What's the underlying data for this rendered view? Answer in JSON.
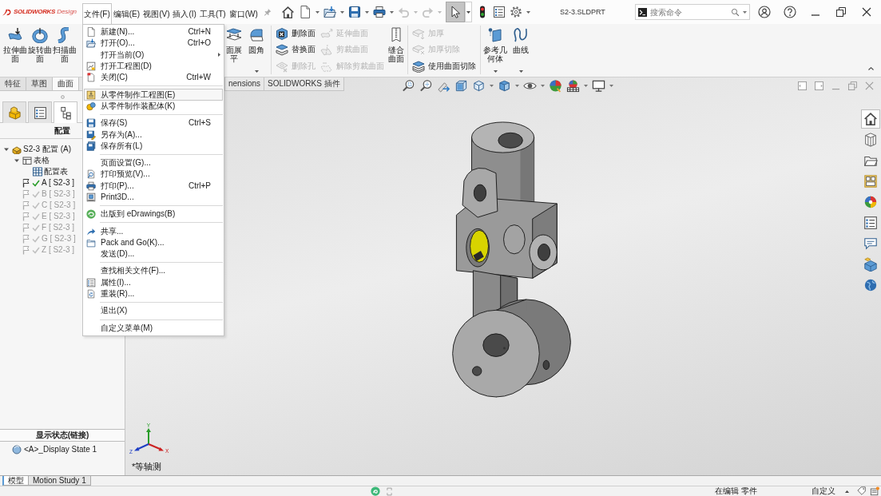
{
  "logo": {
    "brand": "**SOLID**WORKS",
    "edition": "Design"
  },
  "menu_bar": [
    {
      "label": "文件(F)",
      "selected": true
    },
    {
      "label": "编辑(E)",
      "selected": false
    },
    {
      "label": "视图(V)",
      "selected": false
    },
    {
      "label": "插入(I)",
      "selected": false
    },
    {
      "label": "工具(T)",
      "selected": false
    },
    {
      "label": "窗口(W)",
      "selected": false
    }
  ],
  "quick_access": {
    "undo": {
      "disabled": true
    },
    "redo": {
      "disabled": true
    },
    "select": {
      "selected": true
    }
  },
  "document_title": "S2-3.SLDPRT",
  "search": {
    "placeholder": "搜索命令"
  },
  "ribbon": [
    {
      "items": [
        {
          "kind": "large",
          "label": "拉伸曲面",
          "disabled": false,
          "dropdown": false
        },
        {
          "kind": "large",
          "label": "旋转曲面",
          "disabled": false,
          "dropdown": false
        },
        {
          "kind": "large",
          "label": "扫描曲面",
          "disabled": false,
          "dropdown": false
        }
      ]
    },
    {
      "items": [
        {
          "kind": "large",
          "label": "面展平",
          "disabled": false,
          "dropdown": false
        },
        {
          "kind": "large",
          "label": "圆角",
          "disabled": false,
          "dropdown": true
        }
      ]
    },
    {
      "items": [
        {
          "kind": "small",
          "label": "删除面",
          "disabled": false,
          "dropdown": false
        },
        {
          "kind": "small",
          "label": "替换面",
          "disabled": false,
          "dropdown": false
        },
        {
          "kind": "small",
          "label": "删除孔",
          "disabled": true,
          "dropdown": false
        },
        {
          "kind": "small",
          "label": "延伸曲面",
          "disabled": true,
          "dropdown": false
        },
        {
          "kind": "small",
          "label": "剪裁曲面",
          "disabled": true,
          "dropdown": false
        },
        {
          "kind": "small",
          "label": "解除剪裁曲面",
          "disabled": true,
          "dropdown": false
        },
        {
          "kind": "large",
          "label": "缝合曲面",
          "disabled": false,
          "dropdown": false
        }
      ]
    },
    {
      "items": [
        {
          "kind": "small",
          "label": "加厚",
          "disabled": true,
          "dropdown": false
        },
        {
          "kind": "small",
          "label": "加厚切除",
          "disabled": true,
          "dropdown": false
        },
        {
          "kind": "small",
          "label": "使用曲面切除",
          "disabled": false,
          "dropdown": false
        }
      ]
    },
    {
      "items": [
        {
          "kind": "large",
          "label": "参考几何体",
          "disabled": false,
          "dropdown": true
        },
        {
          "kind": "large",
          "label": "曲线",
          "disabled": false,
          "dropdown": true
        }
      ]
    }
  ],
  "command_tabs": [
    {
      "label": "特征",
      "selected": false
    },
    {
      "label": "草图",
      "selected": false
    },
    {
      "label": "曲面",
      "selected": true
    },
    {
      "label": "nensions",
      "selected": false
    },
    {
      "label": "SOLIDWORKS 插件",
      "selected": false
    }
  ],
  "manager_tabs": [
    {
      "selected": false
    },
    {
      "selected": false
    },
    {
      "selected": true
    }
  ],
  "panel_title": "配置",
  "config_tree": [
    {
      "kind": "part",
      "label": "S2-3 配置 (A)",
      "expanded": true,
      "children": [
        {
          "kind": "folder",
          "label": "表格",
          "expanded": true,
          "children": [
            {
              "kind": "table",
              "label": "配置表"
            }
          ]
        },
        {
          "kind": "config",
          "label": "A [ S2-3 ]",
          "active": true
        },
        {
          "kind": "config",
          "label": "B [ S2-3 ]",
          "active": false
        },
        {
          "kind": "config",
          "label": "C [ S2-3 ]",
          "active": false
        },
        {
          "kind": "config",
          "label": "E [ S2-3 ]",
          "active": false
        },
        {
          "kind": "config",
          "label": "F [ S2-3 ]",
          "active": false
        },
        {
          "kind": "config",
          "label": "G [ S2-3 ]",
          "active": false
        },
        {
          "kind": "config",
          "label": "Z [ S2-3 ]",
          "active": false
        }
      ]
    }
  ],
  "display_states": {
    "title": "显示状态(链接)",
    "items": [
      {
        "label": "<A>_Display State 1"
      }
    ]
  },
  "task_pane": [
    {
      "selected": true
    },
    {
      "selected": false
    },
    {
      "selected": false
    },
    {
      "selected": false
    },
    {
      "selected": false
    },
    {
      "selected": false
    },
    {
      "selected": false
    },
    {
      "selected": false
    },
    {
      "selected": false
    }
  ],
  "viewport": {
    "view_name": "*等轴测",
    "axes": [
      "X",
      "Y",
      "Z"
    ]
  },
  "model_tabs": [
    {
      "label": "模型",
      "selected": true
    },
    {
      "label": "Motion Study 1",
      "selected": false
    }
  ],
  "status_bar": {
    "state": "在编辑 零件",
    "units": "自定义"
  },
  "file_menu": [
    {
      "kind": "item",
      "label": "新建(N)...",
      "shortcut": "Ctrl+N",
      "selected": false,
      "submenu": false
    },
    {
      "kind": "item",
      "label": "打开(O)...",
      "shortcut": "Ctrl+O",
      "selected": false,
      "submenu": false
    },
    {
      "kind": "item",
      "label": "打开当前(O)",
      "selected": false,
      "submenu": true
    },
    {
      "kind": "item",
      "label": "打开工程图(D)",
      "selected": false,
      "submenu": false
    },
    {
      "kind": "item",
      "label": "关闭(C)",
      "shortcut": "Ctrl+W",
      "selected": false,
      "submenu": false
    },
    {
      "kind": "separator"
    },
    {
      "kind": "item",
      "label": "从零件制作工程图(E)",
      "selected": true,
      "submenu": false
    },
    {
      "kind": "item",
      "label": "从零件制作装配体(K)",
      "selected": false,
      "submenu": false
    },
    {
      "kind": "separator"
    },
    {
      "kind": "item",
      "label": "保存(S)",
      "shortcut": "Ctrl+S",
      "selected": false,
      "submenu": false
    },
    {
      "kind": "item",
      "label": "另存为(A)...",
      "selected": false,
      "submenu": false
    },
    {
      "kind": "item",
      "label": "保存所有(L)",
      "selected": false,
      "submenu": false
    },
    {
      "kind": "separator"
    },
    {
      "kind": "item",
      "label": "页面设置(G)...",
      "selected": false,
      "submenu": false
    },
    {
      "kind": "item",
      "label": "打印预览(V)...",
      "selected": false,
      "submenu": false
    },
    {
      "kind": "item",
      "label": "打印(P)...",
      "shortcut": "Ctrl+P",
      "selected": false,
      "submenu": false
    },
    {
      "kind": "item",
      "label": "Print3D...",
      "selected": false,
      "submenu": false
    },
    {
      "kind": "separator"
    },
    {
      "kind": "item",
      "label": "出版到 eDrawings(B)",
      "selected": false,
      "submenu": false
    },
    {
      "kind": "separator"
    },
    {
      "kind": "item",
      "label": "共享...",
      "selected": false,
      "submenu": false
    },
    {
      "kind": "item",
      "label": "Pack and Go(K)...",
      "selected": false,
      "submenu": false
    },
    {
      "kind": "item",
      "label": "发送(D)...",
      "selected": false,
      "submenu": false
    },
    {
      "kind": "separator"
    },
    {
      "kind": "item",
      "label": "查找相关文件(F)...",
      "selected": false,
      "submenu": false
    },
    {
      "kind": "item",
      "label": "属性(I)...",
      "selected": false,
      "submenu": false
    },
    {
      "kind": "item",
      "label": "重装(R)...",
      "selected": false,
      "submenu": false
    },
    {
      "kind": "separator"
    },
    {
      "kind": "item",
      "label": "退出(X)",
      "selected": false,
      "submenu": false
    },
    {
      "kind": "separator"
    },
    {
      "kind": "item",
      "label": "自定义菜单(M)",
      "selected": false,
      "submenu": false
    }
  ]
}
